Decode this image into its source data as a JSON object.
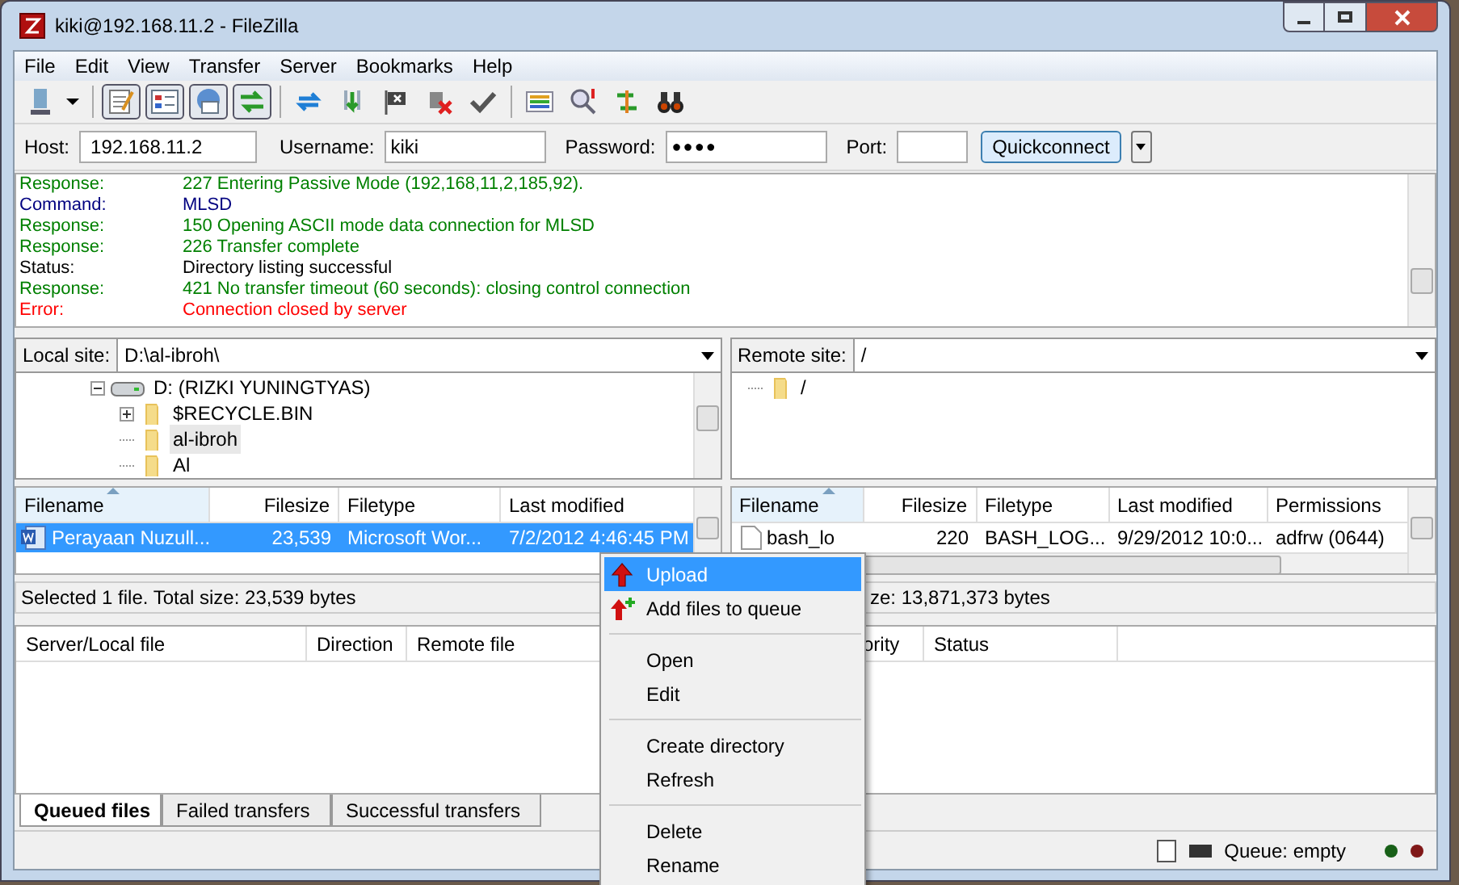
{
  "window": {
    "title": "kiki@192.168.11.2 - FileZilla"
  },
  "menu": [
    "File",
    "Edit",
    "View",
    "Transfer",
    "Server",
    "Bookmarks",
    "Help"
  ],
  "toolbar": [
    {
      "on": false
    },
    {
      "on": true
    },
    {
      "on": true
    },
    {
      "on": true
    },
    {
      "on": true
    },
    {
      "on": false
    },
    {
      "on": false
    },
    {
      "on": false
    },
    {
      "on": false
    },
    {
      "on": false
    },
    {
      "on": false
    },
    {
      "on": false
    },
    {
      "on": false
    },
    {
      "on": false
    }
  ],
  "quickconnect": {
    "host_label": "Host:",
    "host": "192.168.11.2",
    "username_label": "Username:",
    "username": "kiki",
    "password_label": "Password:",
    "password": "●●●●",
    "port_label": "Port:",
    "button": "Quickconnect"
  },
  "log": [
    {
      "kind": "response",
      "label": "Response:",
      "text": "227 Entering Passive Mode (192,168,11,2,185,92)."
    },
    {
      "kind": "command",
      "label": "Command:",
      "text": "MLSD"
    },
    {
      "kind": "response",
      "label": "Response:",
      "text": "150 Opening ASCII mode data connection for MLSD"
    },
    {
      "kind": "response",
      "label": "Response:",
      "text": "226 Transfer complete"
    },
    {
      "kind": "status",
      "label": "Status:",
      "text": "Directory listing successful"
    },
    {
      "kind": "response",
      "label": "Response:",
      "text": "421 No transfer timeout (60 seconds): closing control connection"
    },
    {
      "kind": "error",
      "label": "Error:",
      "text": "Connection closed by server"
    }
  ],
  "local": {
    "site_label": "Local site:",
    "path": "D:\\al-ibroh\\",
    "tree": [
      {
        "label": "D: (RIZKI YUNINGTYAS)",
        "kind": "drive",
        "expanded": true,
        "selected": false,
        "children": [
          {
            "label": "$RECYCLE.BIN",
            "kind": "folder",
            "expanded": false,
            "selected": false
          },
          {
            "label": "al-ibroh",
            "kind": "folder",
            "selected": true
          },
          {
            "label": "Al",
            "kind": "folder",
            "selected": false
          }
        ]
      }
    ],
    "columns": [
      "Filename",
      "Filesize",
      "Filetype",
      "Last modified"
    ],
    "rows": [
      {
        "selected": true,
        "cells": [
          "Perayaan Nuzull...",
          "23,539",
          "Microsoft Wor...",
          "7/2/2012 4:46:45 PM"
        ]
      }
    ],
    "status": "Selected 1 file. Total size: 23,539 bytes"
  },
  "remote": {
    "site_label": "Remote site:",
    "path": "/",
    "tree": [
      {
        "label": "/",
        "kind": "folder",
        "selected": false
      }
    ],
    "columns": [
      "Filename",
      "Filesize",
      "Filetype",
      "Last modified",
      "Permissions"
    ],
    "rows": [
      {
        "selected": false,
        "cells": [
          "bash_lo",
          "220",
          "BASH_LOG...",
          "9/29/2012 10:0...",
          "adfrw (0644)"
        ]
      }
    ],
    "status": "ze: 13,871,373 bytes"
  },
  "queue": {
    "columns": [
      "Server/Local file",
      "Direction",
      "Remote file",
      "ority",
      "Status"
    ]
  },
  "queue_tabs": [
    {
      "label": "Queued files",
      "selected": true
    },
    {
      "label": "Failed transfers",
      "selected": false
    },
    {
      "label": "Successful transfers",
      "selected": false
    }
  ],
  "status_bar": {
    "queue": "Queue: empty"
  },
  "context_menu": [
    {
      "kind": "upload",
      "label": "Upload",
      "selected": true
    },
    {
      "kind": "enqueue",
      "label": "Add files to queue",
      "selected": false
    },
    {
      "kind": "separator"
    },
    {
      "kind": "item",
      "label": "Open",
      "selected": false
    },
    {
      "kind": "item",
      "label": "Edit",
      "selected": false
    },
    {
      "kind": "separator"
    },
    {
      "kind": "item",
      "label": "Create directory",
      "selected": false
    },
    {
      "kind": "item",
      "label": "Refresh",
      "selected": false
    },
    {
      "kind": "separator"
    },
    {
      "kind": "item",
      "label": "Delete",
      "selected": false
    },
    {
      "kind": "item",
      "label": "Rename",
      "selected": false
    }
  ]
}
